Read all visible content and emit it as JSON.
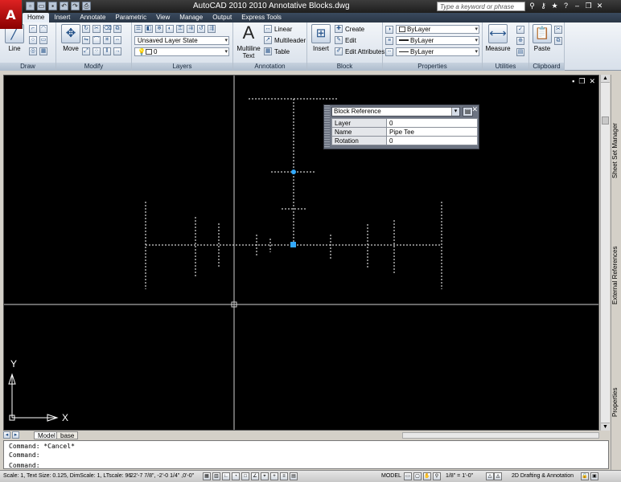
{
  "window": {
    "app_logo": "A",
    "title": "AutoCAD 2010     2010 Annotative Blocks.dwg",
    "search_placeholder": "Type a keyword or phrase",
    "qat_icons": [
      "new-icon",
      "open-icon",
      "save-icon",
      "undo-icon",
      "redo-icon",
      "plot-icon"
    ],
    "title_icons": [
      "binoculars-icon",
      "key-icon",
      "star-icon",
      "help-icon",
      "minimize-icon",
      "restore-icon",
      "close-icon"
    ]
  },
  "ribbon": {
    "tabs": [
      "Home",
      "Insert",
      "Annotate",
      "Parametric",
      "View",
      "Manage",
      "Output",
      "Express Tools"
    ],
    "active_tab": "Home",
    "panels": {
      "draw": {
        "title": "Draw",
        "line_label": "Line"
      },
      "modify": {
        "title": "Modify",
        "move_label": "Move"
      },
      "layers": {
        "title": "Layers",
        "layer_state": "Unsaved Layer State",
        "current_layer": "0"
      },
      "annotation": {
        "title": "Annotation",
        "multiline_text": "Multiline Text",
        "linear": "Linear",
        "multileader": "Multileader",
        "table": "Table"
      },
      "block": {
        "title": "Block",
        "insert": "Insert",
        "create": "Create",
        "edit": "Edit",
        "edit_attributes": "Edit Attributes"
      },
      "properties": {
        "title": "Properties",
        "color": "ByLayer",
        "linetype": "ByLayer",
        "lineweight": "ByLayer"
      },
      "utilities": {
        "title": "Utilities",
        "measure": "Measure"
      },
      "clipboard": {
        "title": "Clipboard",
        "paste": "Paste"
      }
    }
  },
  "quick_properties": {
    "object_type": "Block Reference",
    "rows": [
      {
        "key": "Layer",
        "value": "0"
      },
      {
        "key": "Name",
        "value": "Pipe Tee"
      },
      {
        "key": "Rotation",
        "value": "0"
      }
    ]
  },
  "ucs": {
    "x_label": "X",
    "y_label": "Y"
  },
  "palettes": [
    "Sheet Set Manager",
    "External References",
    "Properties"
  ],
  "layout_tabs": [
    "Model",
    "base"
  ],
  "active_layout": "Model",
  "command_line": {
    "history": [
      "Command: *Cancel*",
      "Command:"
    ],
    "prompt": "Command:",
    "value": ""
  },
  "status_bar": {
    "info": "Scale: 1, Text Size: 0.125, DimScale: 1, LTscale: 96",
    "coords": "22'-7 7/8\",  -2'-0 1/4\"  ,0'-0\"",
    "space": "MODEL",
    "annotation_scale": "1/8\" = 1'-0\"",
    "workspace": "2D Drafting & Annotation"
  },
  "colors": {
    "canvas": "#000000",
    "grip": "#33aaff",
    "geometry": "#ffffff",
    "title_bar": "#2a2a2a",
    "app_button": "#cc1111"
  }
}
